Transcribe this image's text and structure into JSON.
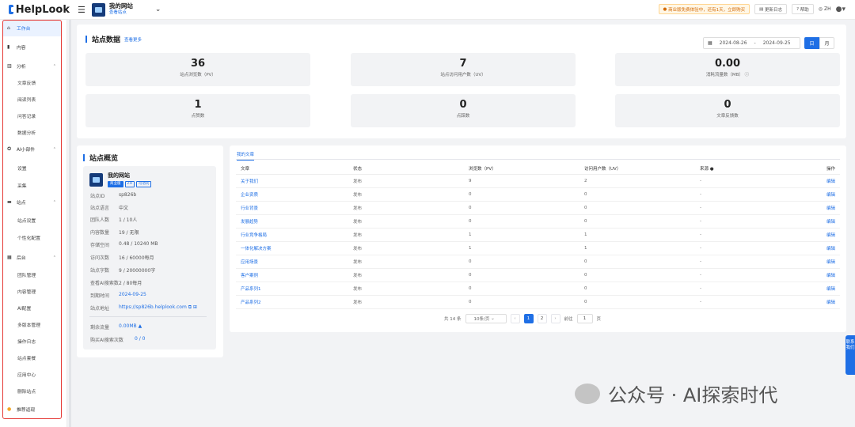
{
  "topbar": {
    "logo": "HelpLook",
    "site_name": "我的网站",
    "site_sub": "查看站点",
    "notice": "商业版免费体验中，还有1天，立即购买",
    "changelog": "更新日志",
    "help": "帮助",
    "lang": "ZH"
  },
  "sidebar": {
    "workbench": "工作台",
    "content": "内容",
    "analysis": "分析",
    "analysis_items": [
      "文章反馈",
      "阅读列表",
      "问答记录",
      "数据分析"
    ],
    "ai_widget": "AI小部件",
    "ai_items": [
      "设置",
      "采集"
    ],
    "site": "站点",
    "site_items": [
      "站点设置",
      "个性化配置"
    ],
    "backend": "后台",
    "backend_items": [
      "团队管理",
      "内容管理",
      "AI配置",
      "多版本管理",
      "操作日志",
      "站点套餐",
      "应用中心",
      "删除站点"
    ],
    "recommend": "推荐返现"
  },
  "stats": {
    "title": "站点数据",
    "more": "查看更多",
    "date_from": "2024-08-26",
    "date_sep": "-",
    "date_to": "2024-09-25",
    "day": "日",
    "month": "月",
    "cards": [
      {
        "value": "36",
        "label": "站点浏览数（PV）"
      },
      {
        "value": "7",
        "label": "站点访问用户数（UV）"
      },
      {
        "value": "0.00",
        "label": "消耗流量数（MB）"
      },
      {
        "value": "1",
        "label": "点赞数"
      },
      {
        "value": "0",
        "label": "点踩数"
      },
      {
        "value": "0",
        "label": "文章反馈数"
      }
    ]
  },
  "overview": {
    "title": "站点概览",
    "site_name": "我的网站",
    "tags": [
      "商业版",
      "ZH",
      "可访问"
    ],
    "rows": [
      {
        "k": "站点ID",
        "v": "sp826b"
      },
      {
        "k": "站点语言",
        "v": "中文"
      },
      {
        "k": "团队人数",
        "v": "1 / 10人"
      },
      {
        "k": "内容数量",
        "v": "19 / 无限"
      },
      {
        "k": "存储空间",
        "v": "0.48 / 10240 MB"
      },
      {
        "k": "访问次数",
        "v": "16 / 60000每月"
      },
      {
        "k": "站点字数",
        "v": "9 / 20000000字"
      },
      {
        "k": "查看AI搜索数",
        "v": "2 / 80每月"
      },
      {
        "k": "到期时间",
        "v": "2024-09-25"
      },
      {
        "k": "站点地址",
        "v": "https://sp826b.helplook.com"
      }
    ],
    "remaining_label": "剩余流量",
    "remaining_value": "0.00MB",
    "buy_label": "购买AI搜索次数",
    "buy_value": "0 / 0"
  },
  "articles": {
    "tab": "我的文章",
    "headers": [
      "文章",
      "状态",
      "浏览数（PV）",
      "访问用户数（UV）",
      "来源",
      "操作"
    ],
    "rows": [
      [
        "关于我们",
        "发布",
        "9",
        "2",
        "-",
        "编辑"
      ],
      [
        "企业资质",
        "发布",
        "0",
        "0",
        "-",
        "编辑"
      ],
      [
        "行业背景",
        "发布",
        "0",
        "0",
        "-",
        "编辑"
      ],
      [
        "发展趋势",
        "发布",
        "0",
        "0",
        "-",
        "编辑"
      ],
      [
        "行业竞争格局",
        "发布",
        "1",
        "1",
        "-",
        "编辑"
      ],
      [
        "一体化解决方案",
        "发布",
        "1",
        "1",
        "-",
        "编辑"
      ],
      [
        "应用场景",
        "发布",
        "0",
        "0",
        "-",
        "编辑"
      ],
      [
        "客户案例",
        "发布",
        "0",
        "0",
        "-",
        "编辑"
      ],
      [
        "产品系列1",
        "发布",
        "0",
        "0",
        "-",
        "编辑"
      ],
      [
        "产品系列2",
        "发布",
        "0",
        "0",
        "-",
        "编辑"
      ]
    ],
    "total": "共 14 条",
    "per_page": "10条/页",
    "pages": [
      "1",
      "2"
    ],
    "goto_label": "前往",
    "goto_value": "1",
    "page_unit": "页"
  },
  "float_tab": "联系我们",
  "watermark": "公众号 · AI探索时代"
}
